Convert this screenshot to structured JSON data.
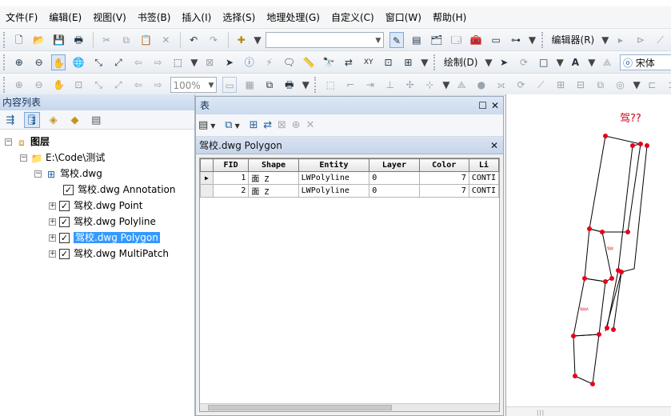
{
  "menu": {
    "items": [
      "文件(F)",
      "编辑(E)",
      "视图(V)",
      "书签(B)",
      "插入(I)",
      "选择(S)",
      "地理处理(G)",
      "自定义(C)",
      "窗口(W)",
      "帮助(H)"
    ]
  },
  "toolbar": {
    "editor_label": "编辑器(R)",
    "draw_label": "绘制(D)",
    "font_name": "宋体",
    "zoom_value": "100%"
  },
  "toc": {
    "title": "内容列表",
    "root_label": "图层",
    "folder_label": "E:\\Code\\测试",
    "dataset_label": "驾校.dwg",
    "layers": [
      {
        "label": "驾校.dwg Annotation",
        "checked": true
      },
      {
        "label": "驾校.dwg Point",
        "checked": true
      },
      {
        "label": "驾校.dwg Polyline",
        "checked": true
      },
      {
        "label": "驾校.dwg Polygon",
        "checked": true,
        "selected": true
      },
      {
        "label": "驾校.dwg MultiPatch",
        "checked": true
      }
    ]
  },
  "table_window": {
    "title": "表",
    "tab_label": "驾校.dwg Polygon",
    "columns": [
      "FID",
      "Shape",
      "Entity",
      "Layer",
      "Color",
      "Li"
    ],
    "rows": [
      {
        "indicator": "▶",
        "FID": "1",
        "Shape": "面 Z",
        "Entity": "LWPolyline",
        "Layer": "0",
        "Color": "7",
        "Li": "CONTI"
      },
      {
        "indicator": "",
        "FID": "2",
        "Shape": "面 Z",
        "Entity": "LWPolyline",
        "Layer": "0",
        "Color": "7",
        "Li": "CONTI"
      }
    ]
  },
  "map": {
    "annotation": "驾??",
    "small_label_1": "驾校",
    "small_label_2": "驾校A",
    "vertex_color": "#e8001c",
    "annotation_color": "#d4001a"
  }
}
